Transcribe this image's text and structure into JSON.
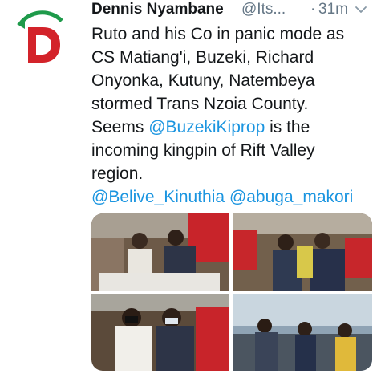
{
  "tweet": {
    "author_name": "Dennis Nyambane",
    "author_handle": "@Its...",
    "separator": "·",
    "timestamp": "31m",
    "avatar_icon": "logo-d-icon",
    "menu_icon": "chevron-down-icon",
    "text_lines": [
      "Ruto and his Co in panic mode as",
      "CS Matiang'i, Buzeki, Richard",
      "Onyonka, Kutuny, Natembeya",
      "stormed Trans Nzoia County.",
      "Seems"
    ],
    "mention_1": "@BuzekiKiprop",
    "text_after_mention": " is the",
    "text_line_6": "incoming kingpin of Rift Valley",
    "text_line_7": "region.",
    "mention_2": "@Belive_Kinuthia",
    "mention_3": "@abuga_makori"
  },
  "colors": {
    "link": "#1b95e0",
    "secondary_text": "#657786",
    "primary_text": "#14171a",
    "logo_red": "#d3232a",
    "logo_green": "#1e9a4a"
  }
}
